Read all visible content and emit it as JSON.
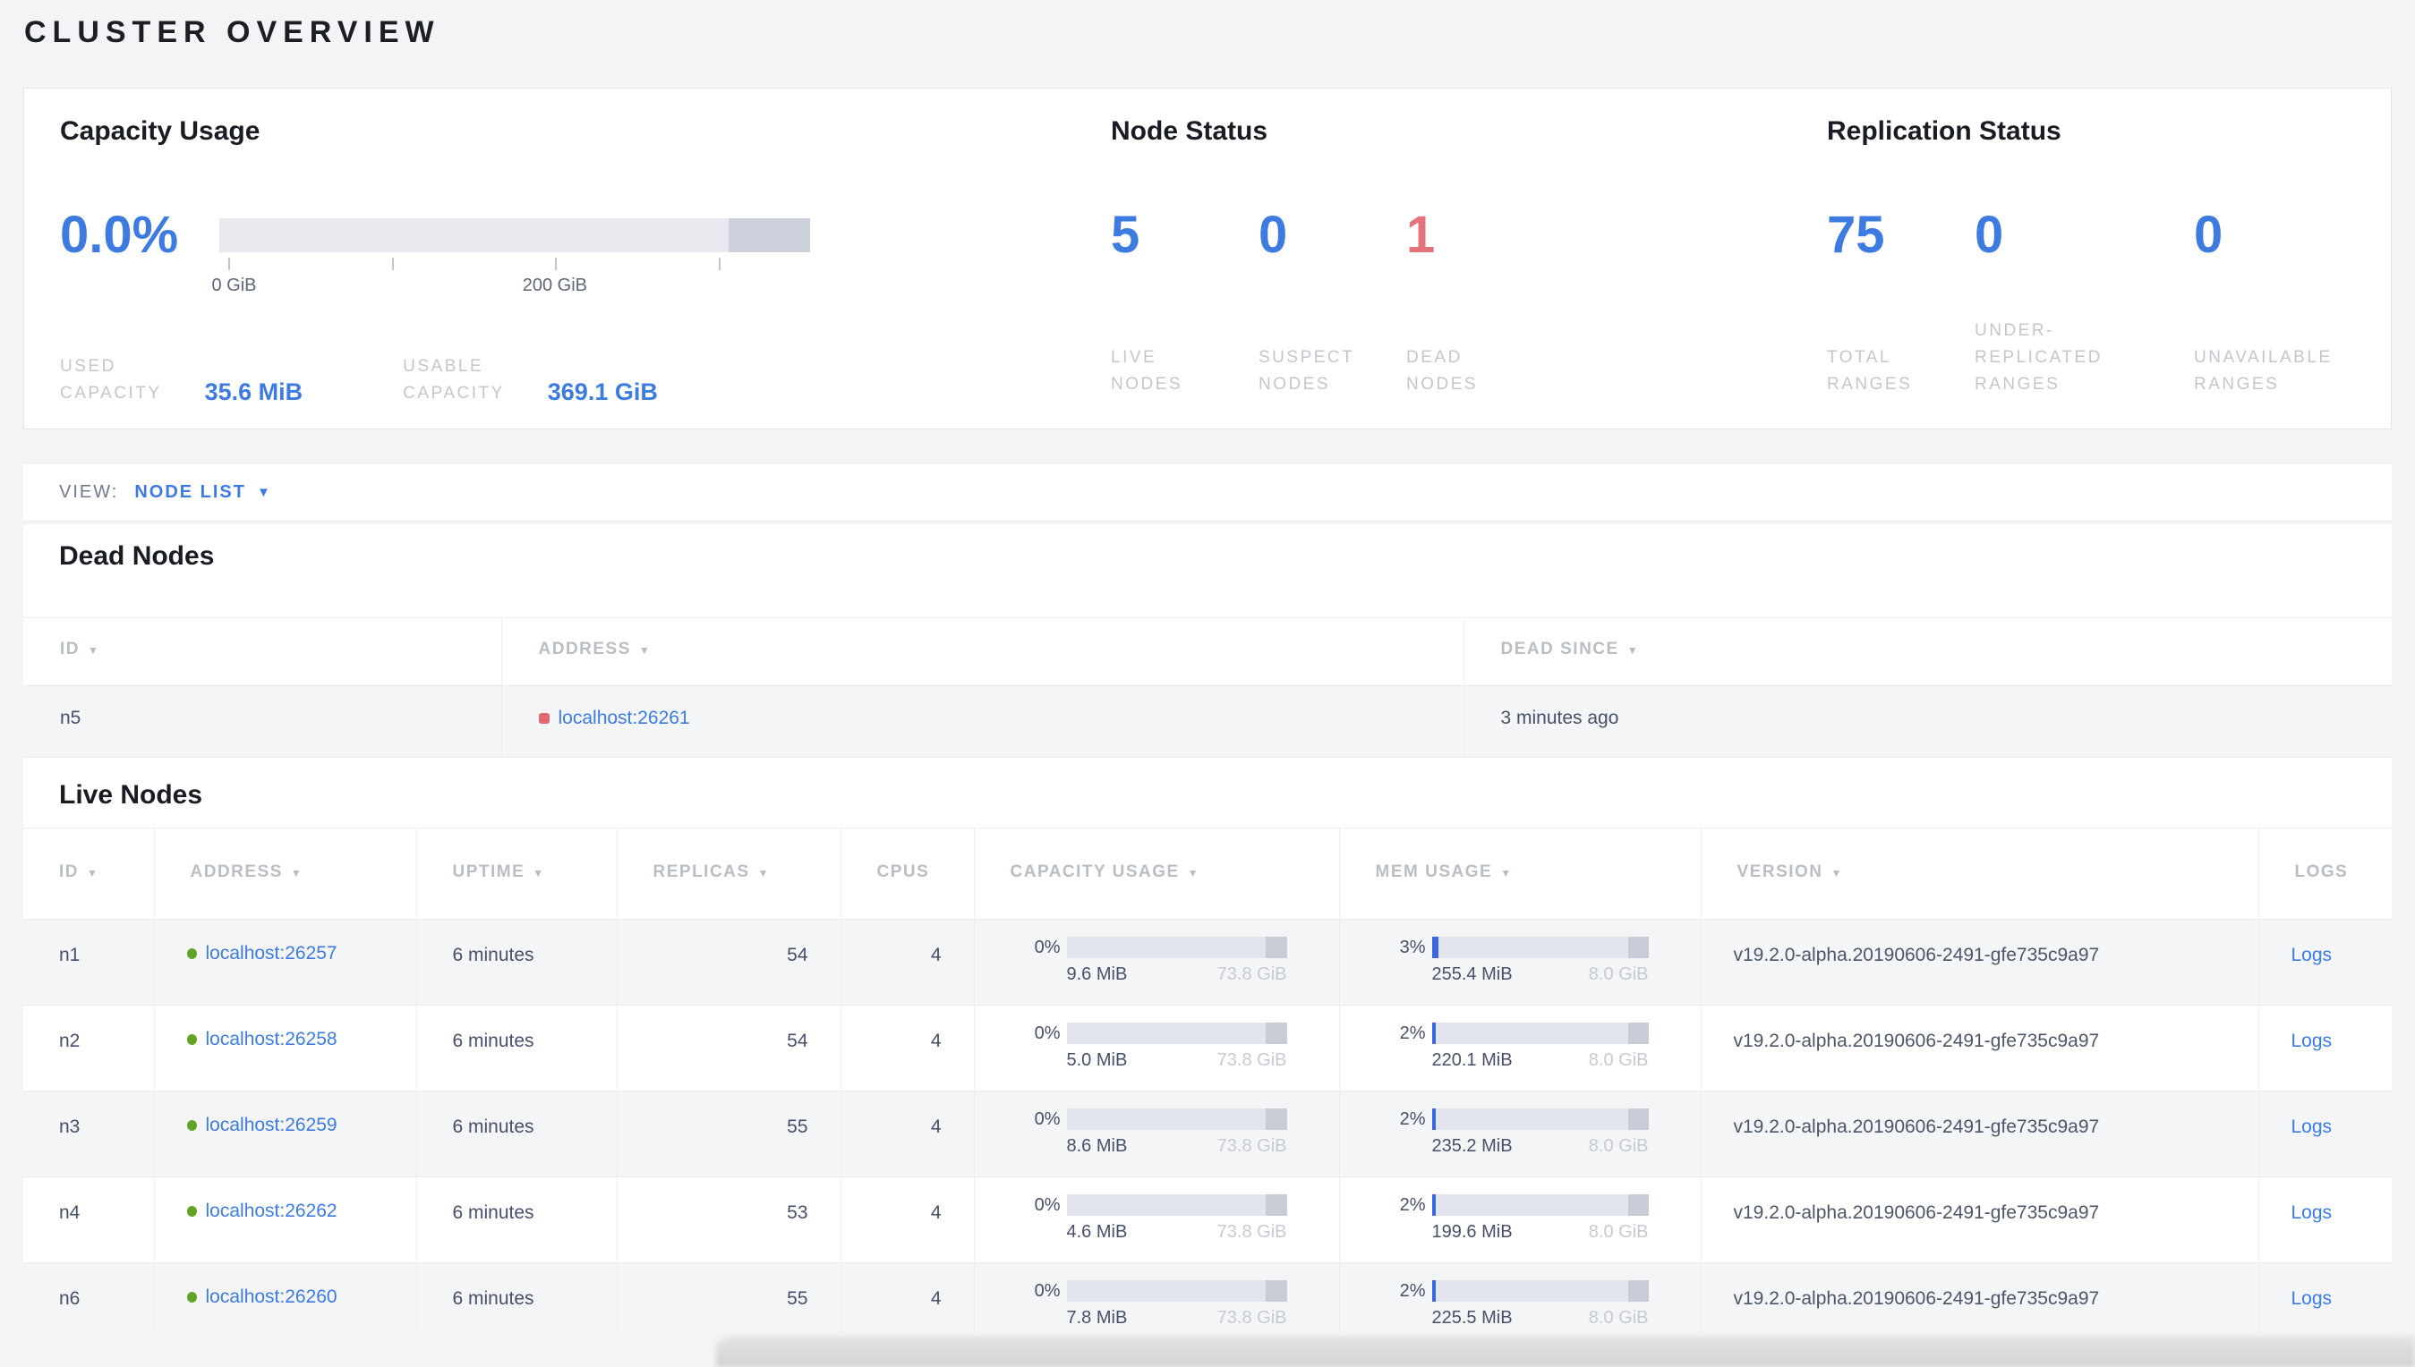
{
  "page": {
    "title": "CLUSTER OVERVIEW"
  },
  "colors": {
    "accent_blue": "#3d7be0",
    "bar_fill_blue": "#3d67e1",
    "dead_red": "#e5737c",
    "live_green": "#61a324",
    "label_gray": "#c3c6cc",
    "bar_track": "#e7e9ee",
    "bar_cap": "#cbd0da"
  },
  "icons": {
    "sort_desc": "▼",
    "dropdown_caret": "▼"
  },
  "overview": {
    "capacity": {
      "title": "Capacity Usage",
      "percent": "0.0%",
      "fill_pct": 0,
      "tick_labels": [
        "0 GiB",
        "200 GiB"
      ],
      "used": {
        "label": "USED\nCAPACITY",
        "value": "35.6 MiB"
      },
      "usable": {
        "label": "USABLE\nCAPACITY",
        "value": "369.1 GiB"
      }
    },
    "node_status": {
      "title": "Node Status",
      "stats": [
        {
          "value": "5",
          "label": "LIVE\nNODES"
        },
        {
          "value": "0",
          "label": "SUSPECT\nNODES"
        },
        {
          "value": "1",
          "label": "DEAD\nNODES"
        }
      ]
    },
    "replication": {
      "title": "Replication Status",
      "stats": [
        {
          "value": "75",
          "label": "TOTAL\nRANGES"
        },
        {
          "value": "0",
          "label": "UNDER-\nREPLICATED\nRANGES"
        },
        {
          "value": "0",
          "label": "UNAVAILABLE\nRANGES"
        }
      ]
    }
  },
  "view_bar": {
    "label": "VIEW:",
    "value": "NODE LIST"
  },
  "dead_nodes": {
    "title": "Dead Nodes",
    "headers": [
      {
        "label": "ID"
      },
      {
        "label": "ADDRESS"
      },
      {
        "label": "DEAD SINCE"
      }
    ],
    "rows": [
      {
        "id": "n5",
        "address": "localhost:26261",
        "dead_since": "3 minutes ago"
      }
    ]
  },
  "live_nodes": {
    "title": "Live Nodes",
    "headers": [
      {
        "label": "ID"
      },
      {
        "label": "ADDRESS"
      },
      {
        "label": "UPTIME"
      },
      {
        "label": "REPLICAS"
      },
      {
        "label": "CPUS"
      },
      {
        "label": "CAPACITY USAGE"
      },
      {
        "label": "MEM USAGE"
      },
      {
        "label": "VERSION"
      },
      {
        "label": "LOGS"
      }
    ],
    "logs_label": "Logs",
    "rows": [
      {
        "id": "n1",
        "address": "localhost:26257",
        "uptime": "6 minutes",
        "replicas": "54",
        "cpus": "4",
        "cap_pct": "0%",
        "cap_fill": 0,
        "cap_used": "9.6 MiB",
        "cap_total": "73.8 GiB",
        "mem_pct": "3%",
        "mem_fill": 3,
        "mem_used": "255.4 MiB",
        "mem_total": "8.0 GiB",
        "version": "v19.2.0-alpha.20190606-2491-gfe735c9a97"
      },
      {
        "id": "n2",
        "address": "localhost:26258",
        "uptime": "6 minutes",
        "replicas": "54",
        "cpus": "4",
        "cap_pct": "0%",
        "cap_fill": 0,
        "cap_used": "5.0 MiB",
        "cap_total": "73.8 GiB",
        "mem_pct": "2%",
        "mem_fill": 2,
        "mem_used": "220.1 MiB",
        "mem_total": "8.0 GiB",
        "version": "v19.2.0-alpha.20190606-2491-gfe735c9a97"
      },
      {
        "id": "n3",
        "address": "localhost:26259",
        "uptime": "6 minutes",
        "replicas": "55",
        "cpus": "4",
        "cap_pct": "0%",
        "cap_fill": 0,
        "cap_used": "8.6 MiB",
        "cap_total": "73.8 GiB",
        "mem_pct": "2%",
        "mem_fill": 2,
        "mem_used": "235.2 MiB",
        "mem_total": "8.0 GiB",
        "version": "v19.2.0-alpha.20190606-2491-gfe735c9a97"
      },
      {
        "id": "n4",
        "address": "localhost:26262",
        "uptime": "6 minutes",
        "replicas": "53",
        "cpus": "4",
        "cap_pct": "0%",
        "cap_fill": 0,
        "cap_used": "4.6 MiB",
        "cap_total": "73.8 GiB",
        "mem_pct": "2%",
        "mem_fill": 2,
        "mem_used": "199.6 MiB",
        "mem_total": "8.0 GiB",
        "version": "v19.2.0-alpha.20190606-2491-gfe735c9a97"
      },
      {
        "id": "n6",
        "address": "localhost:26260",
        "uptime": "6 minutes",
        "replicas": "55",
        "cpus": "4",
        "cap_pct": "0%",
        "cap_fill": 0,
        "cap_used": "7.8 MiB",
        "cap_total": "73.8 GiB",
        "mem_pct": "2%",
        "mem_fill": 2,
        "mem_used": "225.5 MiB",
        "mem_total": "8.0 GiB",
        "version": "v19.2.0-alpha.20190606-2491-gfe735c9a97"
      }
    ]
  }
}
